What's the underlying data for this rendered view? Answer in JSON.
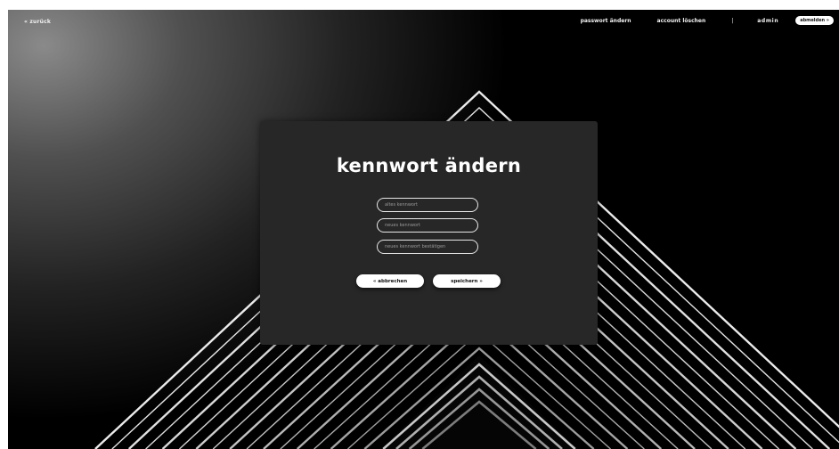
{
  "nav": {
    "back_label": "« zurück",
    "change_password": "passwort ändern",
    "delete_account": "account löschen",
    "separator": "|",
    "username": "admin",
    "logout_label": "abmelden »"
  },
  "dialog": {
    "title": "kennwort ändern",
    "old_password_placeholder": "altes kennwort",
    "new_password_placeholder": "neues kennwort",
    "confirm_password_placeholder": "neues kennwort bestätigen",
    "cancel_label": "« abbrechen",
    "save_label": "speichern »"
  },
  "colors": {
    "modal_background": "#272727",
    "button_background": "#ffffff",
    "text": "#ffffff"
  }
}
